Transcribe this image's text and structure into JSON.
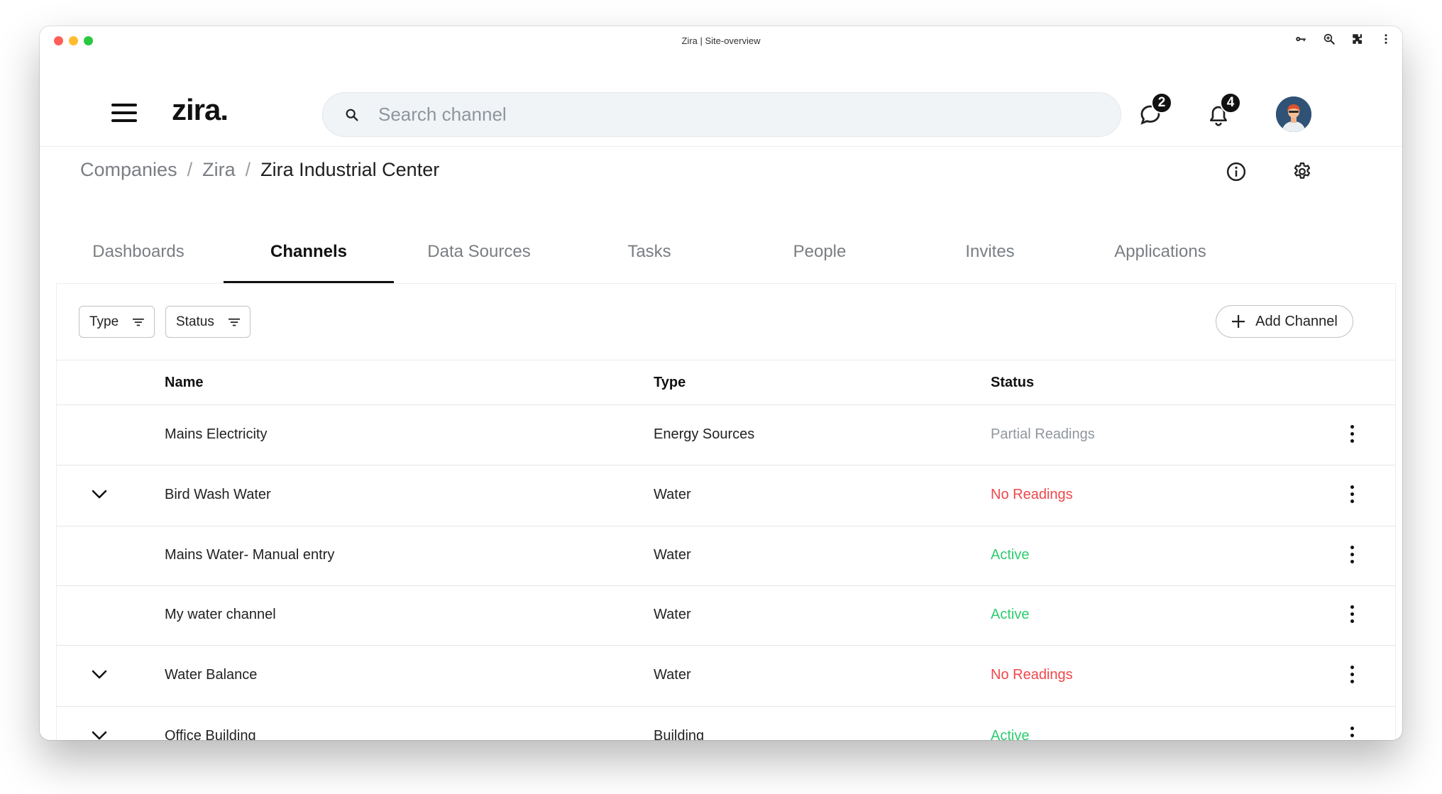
{
  "window": {
    "title": "Zira | Site-overview"
  },
  "header": {
    "logo": "zira.",
    "search": {
      "placeholder": "Search channel",
      "value": ""
    },
    "messages_badge": "2",
    "notifications_badge": "4"
  },
  "breadcrumb": {
    "items": [
      "Companies",
      "Zira"
    ],
    "separator": "/",
    "current": "Zira Industrial Center"
  },
  "tabs": [
    {
      "label": "Dashboards",
      "active": false
    },
    {
      "label": "Channels",
      "active": true
    },
    {
      "label": "Data Sources",
      "active": false
    },
    {
      "label": "Tasks",
      "active": false
    },
    {
      "label": "People",
      "active": false
    },
    {
      "label": "Invites",
      "active": false
    },
    {
      "label": "Applications",
      "active": false
    }
  ],
  "filters": {
    "type_label": "Type",
    "status_label": "Status",
    "add_label": "Add Channel"
  },
  "table": {
    "columns": {
      "name": "Name",
      "type": "Type",
      "status": "Status"
    },
    "rows": [
      {
        "name": "Mains Electricity",
        "type": "Energy Sources",
        "status": "Partial Readings",
        "status_color": "#8f969c",
        "expandable": false
      },
      {
        "name": "Bird Wash Water",
        "type": "Water",
        "status": "No Readings",
        "status_color": "#f0474b",
        "expandable": true
      },
      {
        "name": "Mains Water- Manual entry",
        "type": "Water",
        "status": "Active",
        "status_color": "#2ecc6f",
        "expandable": false
      },
      {
        "name": "My water channel",
        "type": "Water",
        "status": "Active",
        "status_color": "#2ecc6f",
        "expandable": false
      },
      {
        "name": "Water Balance",
        "type": "Water",
        "status": "No Readings",
        "status_color": "#f0474b",
        "expandable": true
      },
      {
        "name": "Office Building",
        "type": "Building",
        "status": "Active",
        "status_color": "#2ecc6f",
        "expandable": true
      }
    ]
  },
  "icons": [
    "hamburger-icon",
    "search-icon",
    "chat-icon",
    "bell-icon",
    "info-icon",
    "gear-icon",
    "filter-icon",
    "plus-icon",
    "chevron-down-icon",
    "kebab-icon"
  ]
}
